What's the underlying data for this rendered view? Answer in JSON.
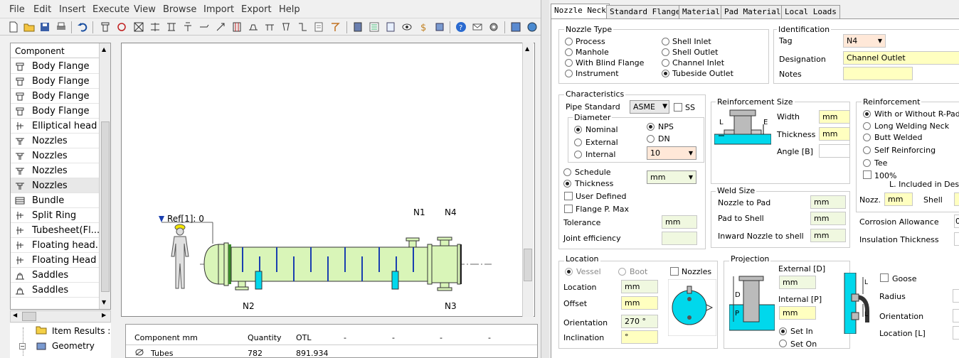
{
  "menu": [
    "File",
    "Edit",
    "Insert",
    "Execute",
    "View",
    "Browse",
    "Import",
    "Export",
    "Help"
  ],
  "component_tree": {
    "header": "Component",
    "items": [
      {
        "label": "Body Flange",
        "icon": "flange-icon"
      },
      {
        "label": "Body Flange",
        "icon": "flange-icon"
      },
      {
        "label": "Body Flange",
        "icon": "flange-icon"
      },
      {
        "label": "Body Flange",
        "icon": "flange-icon"
      },
      {
        "label": "Elliptical head",
        "icon": "head-icon"
      },
      {
        "label": "Nozzles",
        "icon": "nozzle-icon"
      },
      {
        "label": "Nozzles",
        "icon": "nozzle-icon"
      },
      {
        "label": "Nozzles",
        "icon": "nozzle-icon"
      },
      {
        "label": "Nozzles",
        "icon": "nozzle-icon"
      },
      {
        "label": "Bundle",
        "icon": "bundle-icon"
      },
      {
        "label": "Split Ring",
        "icon": "head-icon"
      },
      {
        "label": "Tubesheet(Fl...",
        "icon": "head-icon"
      },
      {
        "label": "Floating head...",
        "icon": "head-icon"
      },
      {
        "label": "Floating Head",
        "icon": "head-icon"
      },
      {
        "label": "Saddles",
        "icon": "saddle-icon"
      },
      {
        "label": "Saddles",
        "icon": "saddle-icon"
      }
    ]
  },
  "lower_tree": {
    "item_results": "Item Results :",
    "geometry": "Geometry"
  },
  "drawing": {
    "ref_label": "Ref[1]: 0",
    "nozzle_labels": [
      "N1",
      "N4",
      "N2",
      "N3"
    ]
  },
  "table": {
    "headers": [
      "Component mm",
      "Quantity",
      "OTL",
      "-",
      "-",
      "-",
      "-"
    ],
    "rows": [
      [
        "Tubes",
        "782",
        "891.934"
      ]
    ]
  },
  "tabs": [
    "Nozzle Neck",
    "Standard Flange",
    "Material",
    "Pad Material",
    "Local Loads"
  ],
  "nozzle_type": {
    "title": "Nozzle Type",
    "options": [
      "Process",
      "Manhole",
      "With Blind Flange",
      "Instrument",
      "Shell Inlet",
      "Shell Outlet",
      "Channel Inlet",
      "Tubeside Outlet"
    ]
  },
  "identification": {
    "title": "Identification",
    "tag_label": "Tag",
    "tag_value": "N4",
    "designation_label": "Designation",
    "designation_value": "Channel Outlet",
    "notes_label": "Notes"
  },
  "characteristics": {
    "title": "Characteristics",
    "pipe_standard_label": "Pipe Standard",
    "pipe_standard_value": "ASME",
    "ss_label": "SS",
    "diameter_label": "Diameter",
    "diameter_options": [
      "Nominal",
      "External",
      "Internal"
    ],
    "nps_label": "NPS",
    "dn_label": "DN",
    "size_value": "10",
    "schedule_label": "Schedule",
    "thickness_label": "Thickness",
    "unit_value": "mm",
    "user_defined_label": "User Defined",
    "flange_pmax_label": "Flange P. Max",
    "tolerance_label": "Tolerance",
    "tolerance_unit": "mm",
    "joint_eff_label": "Joint efficiency"
  },
  "reinf_size": {
    "title": "Reinforcement Size",
    "width_label": "Width",
    "thickness_label": "Thickness",
    "angle_label": "Angle [B]",
    "unit": "mm",
    "dim_l": "L",
    "dim_e": "E"
  },
  "weld_size": {
    "title": "Weld Size",
    "labels": [
      "Nozzle to Pad",
      "Pad to Shell",
      "Inward Nozzle to shell"
    ],
    "unit": "mm"
  },
  "reinforcement": {
    "title": "Reinforcement",
    "options": [
      "With or Without R-Pad",
      "Long Welding Neck",
      "Butt Welded",
      "Self Reinforcing",
      "Tee"
    ],
    "pct_label": "100%",
    "included_label": "L. Included in Des",
    "nozz_label": "Nozz.",
    "shell_label": "Shell",
    "unit": "mm",
    "corrosion_label": "Corrosion Allowance",
    "insulation_label": "Insulation Thickness",
    "corrosion_partial": "0"
  },
  "location": {
    "title": "Location",
    "vessel_label": "Vessel",
    "boot_label": "Boot",
    "nozzles_label": "Nozzles",
    "location_label": "Location",
    "offset_label": "Offset",
    "orientation_label": "Orientation",
    "inclination_label": "Inclination",
    "unit": "mm",
    "orientation_value": "270 °",
    "inclination_value": "°"
  },
  "projection": {
    "title": "Projection",
    "external_label": "External [D]",
    "internal_label": "Internal [P]",
    "unit": "mm",
    "set_in_label": "Set In",
    "set_on_label": "Set On",
    "dim_d": "D",
    "dim_p": "P"
  },
  "goose": {
    "goose_label": "Goose",
    "radius_label": "Radius",
    "orientation_label": "Orientation",
    "location_label": "Location [L]",
    "dim_l": "L"
  }
}
